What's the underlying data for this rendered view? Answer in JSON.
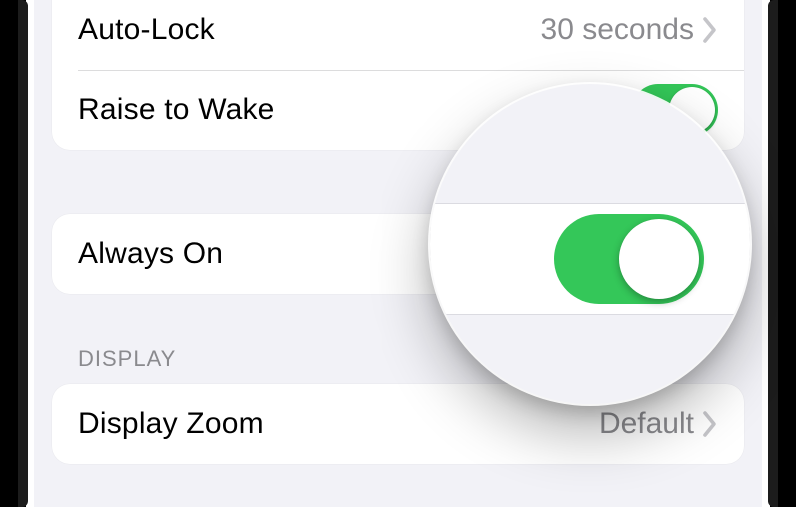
{
  "settings": {
    "group1": {
      "autoLock": {
        "label": "Auto-Lock",
        "value": "30 seconds"
      },
      "raiseToWake": {
        "label": "Raise to Wake",
        "enabled": true
      }
    },
    "group2": {
      "alwaysOn": {
        "label": "Always On",
        "enabled": true
      }
    },
    "displaySection": {
      "header": "DISPLAY",
      "displayZoom": {
        "label": "Display Zoom",
        "value": "Default"
      }
    }
  },
  "colors": {
    "toggleOn": "#34c759",
    "secondaryText": "#8a8a8e",
    "background": "#f2f2f7"
  }
}
